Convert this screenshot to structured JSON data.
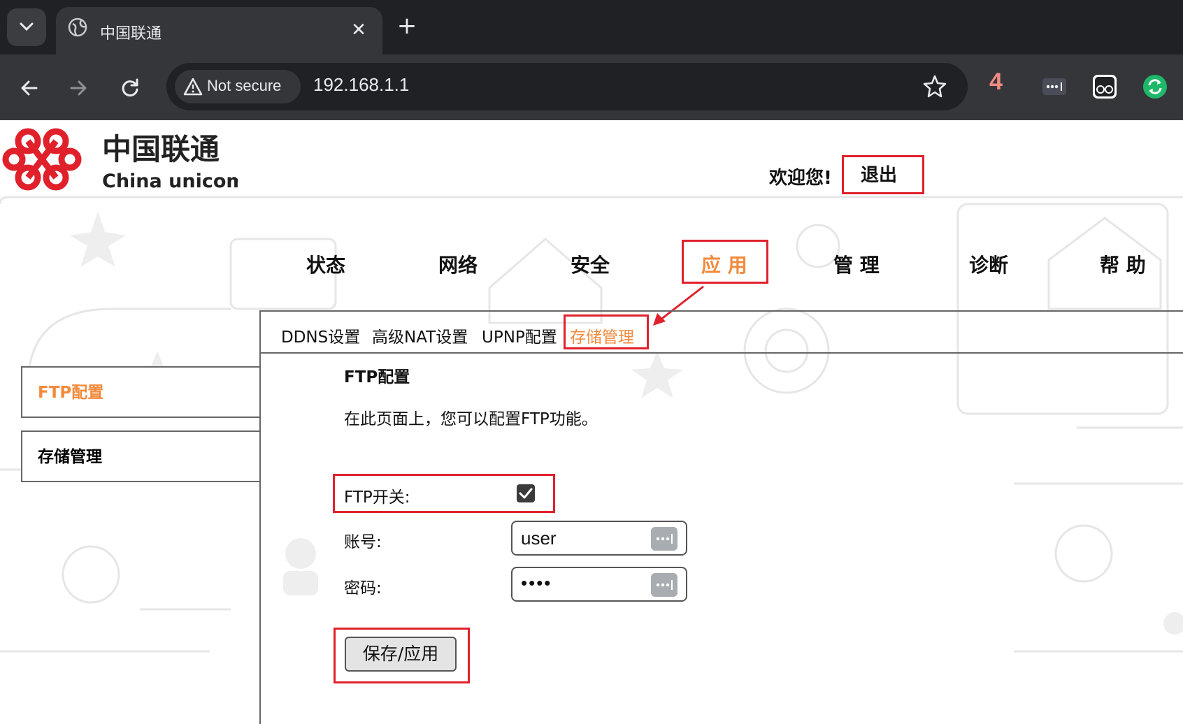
{
  "browser": {
    "tab_title": "中国联通",
    "security_label": "Not secure",
    "url": "192.168.1.1",
    "extension_count": "4",
    "accent_color": "#f28b82"
  },
  "header": {
    "logo_cn": "中国联通",
    "logo_en": "China unicom",
    "welcome": "欢迎您!",
    "logout": "退出"
  },
  "main_nav": [
    "状态",
    "网络",
    "安全",
    "应 用",
    "管 理",
    "诊断",
    "帮 助"
  ],
  "main_nav_active": "应 用",
  "sub_nav": [
    "DDNS设置",
    "高级NAT设置",
    "UPNP配置",
    "存储管理"
  ],
  "sub_nav_active": "存储管理",
  "sidebar": [
    "FTP配置",
    "存储管理"
  ],
  "sidebar_active": "FTP配置",
  "content": {
    "title": "FTP配置",
    "description": "在此页面上，您可以配置FTP功能。",
    "ftp_switch_label": "FTP开关:",
    "ftp_switch_checked": true,
    "account_label": "账号:",
    "account_value": "user",
    "password_label": "密码:",
    "password_value": "••••",
    "save_button": "保存/应用"
  },
  "colors": {
    "highlight": "#e0212c",
    "active_text": "#f28a3c"
  }
}
